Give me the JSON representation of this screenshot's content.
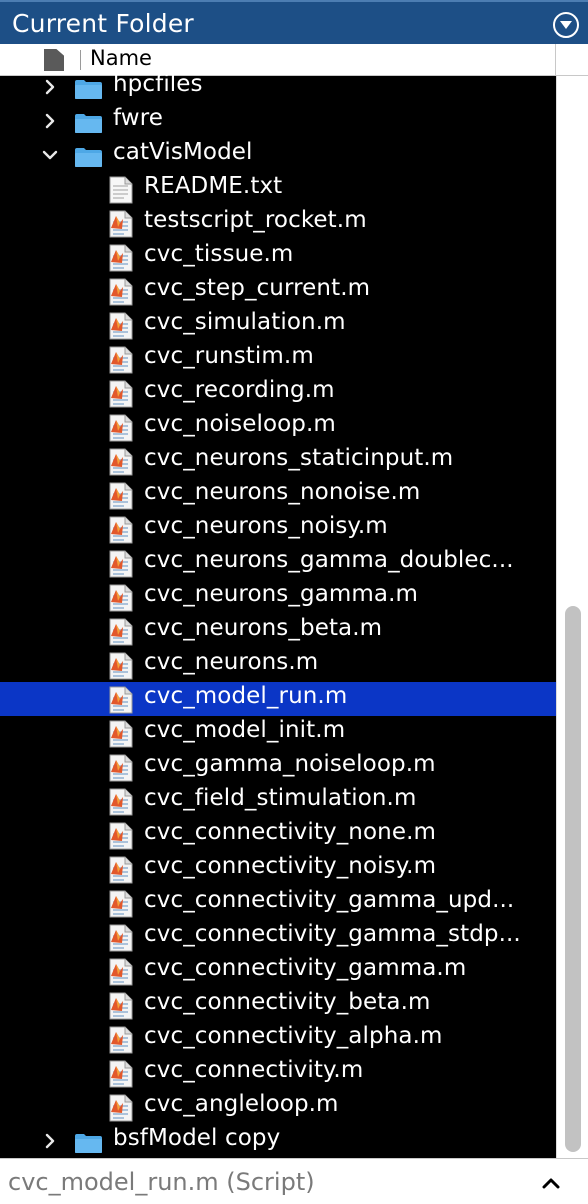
{
  "panel": {
    "title": "Current Folder",
    "column_name": "Name"
  },
  "tree": [
    {
      "label": "hpcfiles",
      "type": "folder",
      "state": "collapsed",
      "level": 0
    },
    {
      "label": "fwre",
      "type": "folder",
      "state": "collapsed",
      "level": 0
    },
    {
      "label": "catVisModel",
      "type": "folder",
      "state": "expanded",
      "level": 0
    },
    {
      "label": "README.txt",
      "type": "txt",
      "level": 1
    },
    {
      "label": "testscript_rocket.m",
      "type": "m",
      "level": 1
    },
    {
      "label": "cvc_tissue.m",
      "type": "m",
      "level": 1
    },
    {
      "label": "cvc_step_current.m",
      "type": "m",
      "level": 1
    },
    {
      "label": "cvc_simulation.m",
      "type": "m",
      "level": 1
    },
    {
      "label": "cvc_runstim.m",
      "type": "m",
      "level": 1
    },
    {
      "label": "cvc_recording.m",
      "type": "m",
      "level": 1
    },
    {
      "label": "cvc_noiseloop.m",
      "type": "m",
      "level": 1
    },
    {
      "label": "cvc_neurons_staticinput.m",
      "type": "m",
      "level": 1
    },
    {
      "label": "cvc_neurons_nonoise.m",
      "type": "m",
      "level": 1
    },
    {
      "label": "cvc_neurons_noisy.m",
      "type": "m",
      "level": 1
    },
    {
      "label": "cvc_neurons_gamma_doublec...",
      "type": "m",
      "level": 1
    },
    {
      "label": "cvc_neurons_gamma.m",
      "type": "m",
      "level": 1
    },
    {
      "label": "cvc_neurons_beta.m",
      "type": "m",
      "level": 1
    },
    {
      "label": "cvc_neurons.m",
      "type": "m",
      "level": 1
    },
    {
      "label": "cvc_model_run.m",
      "type": "m",
      "level": 1,
      "selected": true
    },
    {
      "label": "cvc_model_init.m",
      "type": "m",
      "level": 1
    },
    {
      "label": "cvc_gamma_noiseloop.m",
      "type": "m",
      "level": 1
    },
    {
      "label": "cvc_field_stimulation.m",
      "type": "m",
      "level": 1
    },
    {
      "label": "cvc_connectivity_none.m",
      "type": "m",
      "level": 1
    },
    {
      "label": "cvc_connectivity_noisy.m",
      "type": "m",
      "level": 1
    },
    {
      "label": "cvc_connectivity_gamma_upd...",
      "type": "m",
      "level": 1
    },
    {
      "label": "cvc_connectivity_gamma_stdp...",
      "type": "m",
      "level": 1
    },
    {
      "label": "cvc_connectivity_gamma.m",
      "type": "m",
      "level": 1
    },
    {
      "label": "cvc_connectivity_beta.m",
      "type": "m",
      "level": 1
    },
    {
      "label": "cvc_connectivity_alpha.m",
      "type": "m",
      "level": 1
    },
    {
      "label": "cvc_connectivity.m",
      "type": "m",
      "level": 1
    },
    {
      "label": "cvc_angleloop.m",
      "type": "m",
      "level": 1
    },
    {
      "label": "bsfModel copy",
      "type": "folder",
      "state": "collapsed",
      "level": 0
    }
  ],
  "status": {
    "text": "cvc_model_run.m  (Script)"
  },
  "colors": {
    "title_bg": "#1d4f86",
    "tree_bg": "#000000",
    "selection": "#0b36c6",
    "folder": "#4ea8e6"
  },
  "icons": {
    "panel_menu": "circle-down-triangle-icon",
    "file_header": "file-icon",
    "collapsed": "chevron-right-icon",
    "expanded": "chevron-down-icon",
    "folder": "folder-icon",
    "m_file": "matlab-script-icon",
    "txt_file": "text-file-icon",
    "status_expand": "caret-up-icon"
  }
}
